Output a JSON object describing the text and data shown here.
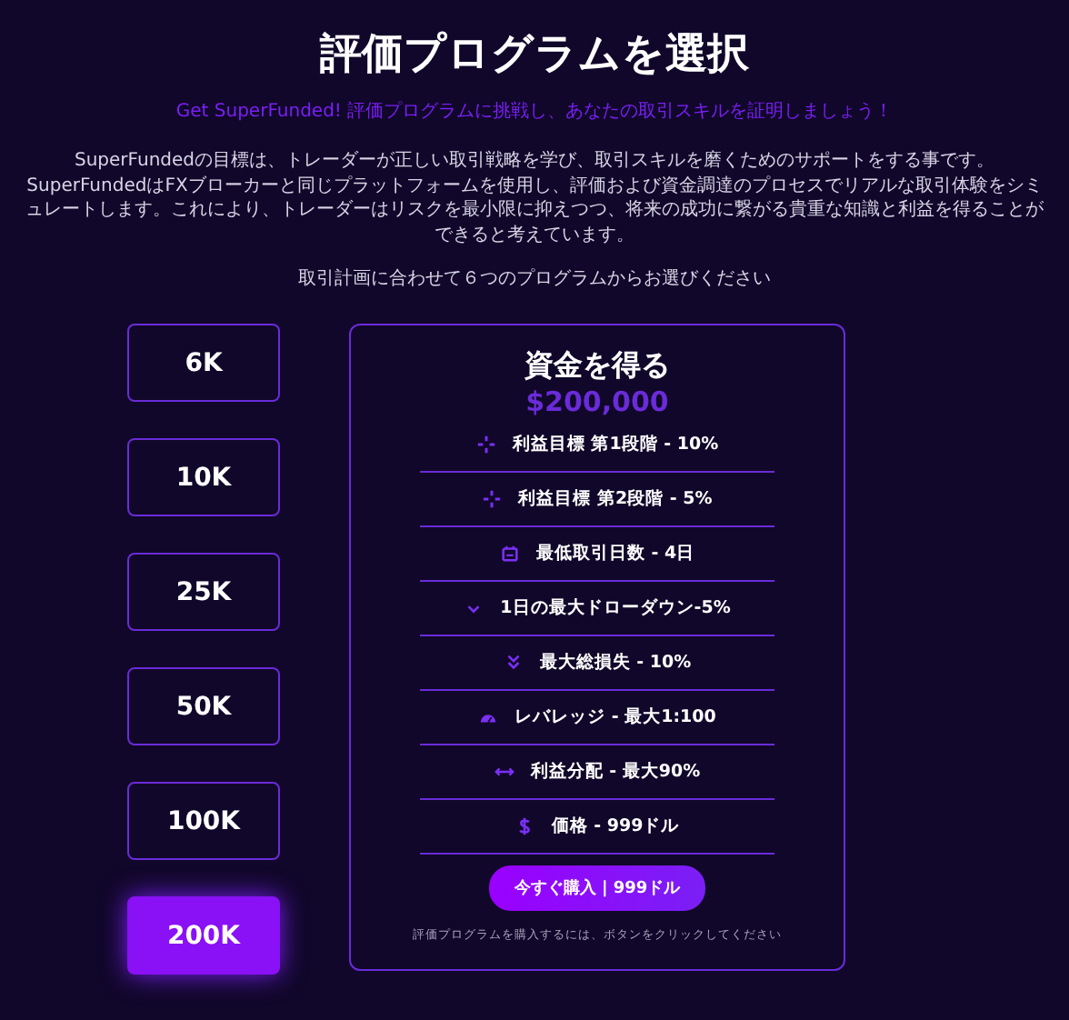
{
  "title": "評価プログラムを選択",
  "subtitle": "Get SuperFunded! 評価プログラムに挑戦し、あなたの取引スキルを証明しましょう！",
  "description": "SuperFundedの目標は、トレーダーが正しい取引戦略を学び、取引スキルを磨くためのサポートをする事です。SuperFundedはFXブローカーと同じプラットフォームを使用し、評価および資金調達のプロセスでリアルな取引体験をシミュレートします。これにより、トレーダーはリスクを最小限に抑えつつ、将来の成功に繋がる貴重な知識と利益を得ることができると考えています。",
  "hint": "取引計画に合わせて６つのプログラムからお選びください",
  "programs": [
    {
      "label": "6K",
      "selected": false
    },
    {
      "label": "10K",
      "selected": false
    },
    {
      "label": "25K",
      "selected": false
    },
    {
      "label": "50K",
      "selected": false
    },
    {
      "label": "100K",
      "selected": false
    },
    {
      "label": "200K",
      "selected": true
    }
  ],
  "card": {
    "heading": "資金を得る",
    "amount": "$200,000",
    "features": [
      "利益目標 第1段階 - 10%",
      "利益目標 第2段階 - 5%",
      "最低取引日数 - 4日",
      "1日の最大ドローダウン-5%",
      "最大総損失 - 10%",
      "レバレッジ - 最大1:100",
      "利益分配 - 最大90%",
      "価格 - 999ドル"
    ],
    "button": "今すぐ購入 | 999ドル",
    "note": "評価プログラムを購入するには、ボタンをクリックしてください"
  }
}
